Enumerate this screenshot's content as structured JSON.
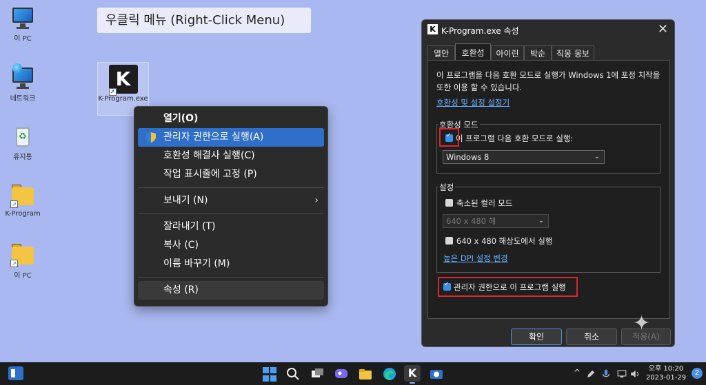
{
  "desktop": {
    "icons": [
      {
        "label": "이 PC",
        "icon": "monitor-icon"
      },
      {
        "label": "네트워크",
        "icon": "network-icon"
      },
      {
        "label": "휴지통",
        "icon": "recycle-bin-icon"
      },
      {
        "label": "K-Program",
        "icon": "folder-shortcut-icon"
      },
      {
        "label": "이 PC",
        "icon": "folder-shortcut-icon"
      }
    ],
    "selected_icon": {
      "label": "K-Program.exe",
      "glyph": "K"
    },
    "shortcut_glyph": "↗"
  },
  "heading": "우클릭 메뉴 (Right-Click Menu)",
  "context_menu": {
    "items": [
      {
        "label": "열기(O)",
        "bold": true
      },
      {
        "label": "관리자 권한으로 실행(A)",
        "active": true,
        "icon": "uac-shield-icon"
      },
      {
        "label": "호환성 해결사 실행(C)"
      },
      {
        "label": "작업 표시줄에 고정 (P)"
      },
      {
        "label": "보내기 (N)",
        "submenu": true
      },
      {
        "label": "잘라내기 (T)"
      },
      {
        "label": "복사 (C)"
      },
      {
        "label": "이름 바꾸기 (M)"
      },
      {
        "label": "속성 (R)",
        "hover": true
      }
    ],
    "submenu_arrow": "›"
  },
  "dialog": {
    "title": "K-Program.exe 속성",
    "app_glyph": "K",
    "close_glyph": "✕",
    "tabs": [
      "열안",
      "호환성",
      "아이린",
      "박순",
      "직몽 몽보"
    ],
    "selected_tab": 1,
    "description": "이 프로그램을 다음 호환 모드로 실행가 Windows 1에 포정 치작을 또한 이용 할 수 있습니다.",
    "link_troubleshooter": "호환성 및 설정 설정기",
    "compat_group": {
      "title": "호환성 모드",
      "checkbox_label": "이 프로그램 다음 호환 모드로 실행:",
      "checked": true,
      "select_value": "Windows 8",
      "chevron": "⌄"
    },
    "settings_group": {
      "title": "설정",
      "reduced_color_label": "축소된 컬러 모드",
      "reduced_color_checked": false,
      "color_select_value": "640 x 480 해",
      "res_label": "640 x 480 해상도에서 실행",
      "res_checked": false,
      "dpi_link": "높은 DPI 설정 변경"
    },
    "admin_checkbox_label": "관리자 권한으로 이 프로그램 실행",
    "admin_checked": true,
    "buttons": {
      "ok": "확인",
      "cancel": "취소",
      "apply": "적용(A)"
    }
  },
  "taskbar": {
    "clock_time": "오후 10:20",
    "clock_date": "2023-01-29",
    "notification_count": "2",
    "tray_arrow": "^",
    "app_k_glyph": "K",
    "icons": [
      "start-icon",
      "search-icon",
      "task-view-icon",
      "chat-icon",
      "file-explorer-icon",
      "edge-icon",
      "k-program-icon",
      "capture-icon"
    ]
  },
  "colors": {
    "desktop_bg": "#a9b8f0",
    "menu_bg": "#2b2b2b",
    "accent": "#2f6fc9",
    "highlight_box": "#e0262a",
    "link": "#66b0ff"
  }
}
